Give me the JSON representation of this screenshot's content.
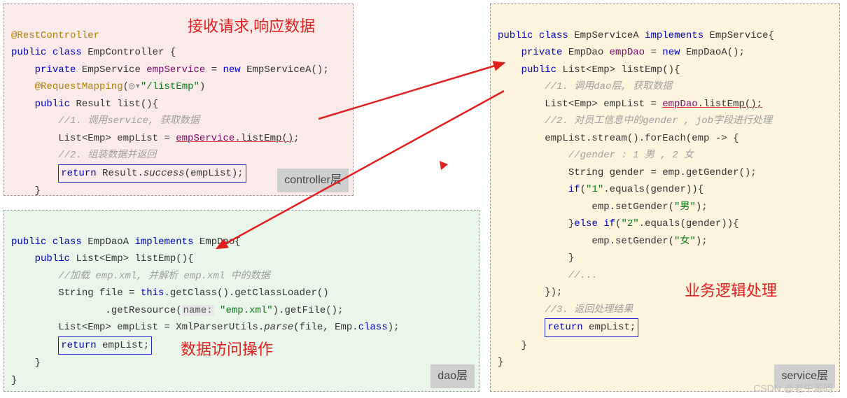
{
  "callouts": {
    "controller": "接收请求,响应数据",
    "dao": "数据访问操作",
    "service": "业务逻辑处理"
  },
  "layer_tags": {
    "controller": "controller层",
    "dao": "dao层",
    "service": "service层"
  },
  "controller": {
    "ann_rest": "@RestController",
    "decl_a": "public",
    "decl_b": "class",
    "decl_c": "EmpController {",
    "fld_a": "private",
    "fld_b": "EmpService",
    "fld_c": "empService",
    "fld_d": "= ",
    "fld_e": "new",
    "fld_f": "EmpServiceA();",
    "map_a": "@RequestMapping",
    "map_b": "(",
    "map_globe": "◎▾",
    "map_c": "\"/listEmp\"",
    "map_d": ")",
    "m_a": "public",
    "m_b": "Result list(){",
    "c1": "//1. 调用service, 获取数据",
    "l1a": "List<Emp> empList = ",
    "l1b": "empService",
    "l1c": ".listEmp()",
    "l1d": ";",
    "c2": "//2. 组装数据并返回",
    "ret_a": "return",
    "ret_b": " Result.",
    "ret_c": "success",
    "ret_d": "(empList);",
    "close1": "}",
    "close2": "}"
  },
  "dao": {
    "decl_a": "public",
    "decl_b": "class",
    "decl_c": "EmpDaoA",
    "decl_d": "implements",
    "decl_e": "EmpDao{",
    "m_a": "public",
    "m_b": "List<Emp> listEmp(){",
    "c1": "//加载 emp.xml, 并解析 emp.xml 中的数据",
    "l1a": "String file = ",
    "l1b": "this",
    "l1c": ".getClass().getClassLoader()",
    "l2a": "                .getResource(",
    "l2hint": "name:",
    "l2str": " \"emp.xml\"",
    "l2b": ").getFile();",
    "l3a": "List<Emp> empList = XmlParserUtils.",
    "l3b": "parse",
    "l3c": "(file, Emp.",
    "l3d": "class",
    "l3e": ");",
    "ret_a": "return",
    "ret_b": " empList;",
    "close1": "}",
    "close2": "}"
  },
  "service": {
    "decl_a": "public",
    "decl_b": "class",
    "decl_c": "EmpServiceA",
    "decl_d": "implements",
    "decl_e": "EmpService{",
    "fld_a": "private",
    "fld_b": "EmpDao",
    "fld_c": "empDao",
    "fld_d": "= ",
    "fld_e": "new",
    "fld_f": "EmpDaoA();",
    "m_a": "public",
    "m_b": "List<Emp> listEmp(){",
    "c1": "//1. 调用dao层, 获取数据",
    "l1a": "List<Emp> empList = ",
    "l1b": "empDao",
    "l1c": ".listEmp();",
    "c2": "//2. 对员工信息中的gender , job字段进行处理",
    "l2a": "empList.stream().forEach(emp -> {",
    "c3": "//gender : 1 男 , 2 女",
    "l3a": "String gender = emp.getGender();",
    "l4a": "if",
    "l4b": "(",
    "l4c": "\"1\"",
    "l4d": ".equals(gender)){",
    "l5a": "emp.setGender(",
    "l5b": "\"男\"",
    "l5c": ");",
    "l6a": "}",
    "l6b": "else if",
    "l6c": "(",
    "l6d": "\"2\"",
    "l6e": ".equals(gender)){",
    "l7a": "emp.setGender(",
    "l7b": "\"女\"",
    "l7c": ");",
    "l8a": "}",
    "c4": "//...",
    "l9a": "});",
    "c5": "//3. 返回处理结果",
    "ret_a": "return",
    "ret_b": " empList;",
    "close1": "}",
    "close2": "}"
  },
  "watermark": "CSDN @老牛源码"
}
